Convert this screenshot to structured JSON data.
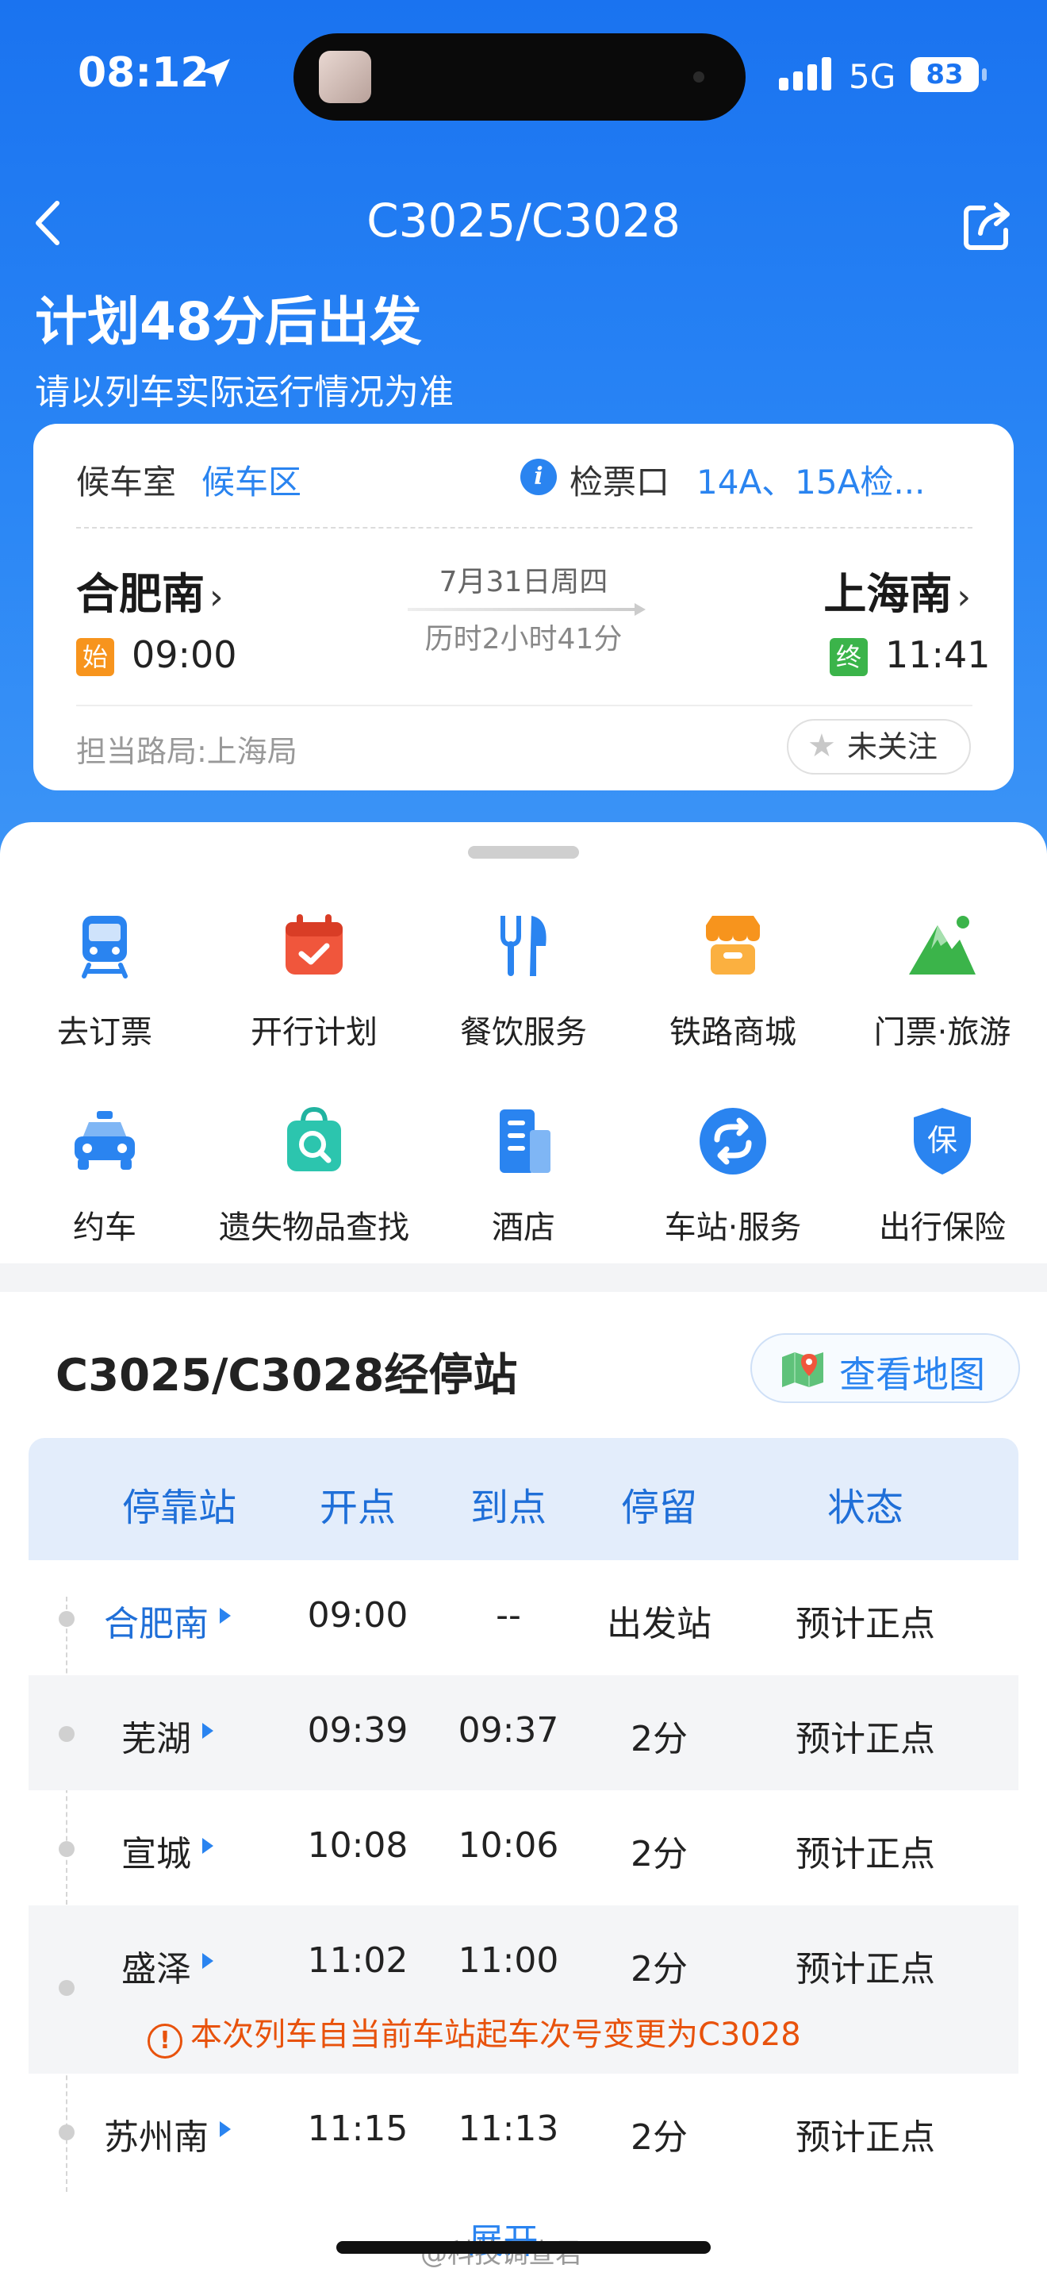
{
  "status_bar": {
    "time": "08:12",
    "network": "5G",
    "battery": "83"
  },
  "nav": {
    "title": "C3025/C3028"
  },
  "header": {
    "title": "计划48分后出发",
    "subtitle": "请以列车实际运行情况为准"
  },
  "trip_card": {
    "waiting_room_label": "候车室",
    "waiting_room_value": "候车区",
    "gate_label": "检票口",
    "gate_value": "14A、15A检...",
    "from_station": "合肥南",
    "from_badge": "始",
    "from_time": "09:00",
    "to_station": "上海南",
    "to_badge": "终",
    "to_time": "11:41",
    "date": "7月31日周四",
    "duration": "历时2小时41分",
    "bureau": "担当路局:上海局",
    "follow_label": "未关注"
  },
  "services": [
    {
      "label": "去订票",
      "icon": "train-ticket-icon"
    },
    {
      "label": "开行计划",
      "icon": "calendar-icon"
    },
    {
      "label": "餐饮服务",
      "icon": "dining-icon"
    },
    {
      "label": "铁路商城",
      "icon": "shop-icon"
    },
    {
      "label": "门票·旅游",
      "icon": "mountain-icon"
    },
    {
      "label": "约车",
      "icon": "taxi-icon"
    },
    {
      "label": "遗失物品查找",
      "icon": "lost-found-icon"
    },
    {
      "label": "酒店",
      "icon": "hotel-icon"
    },
    {
      "label": "车站·服务",
      "icon": "station-service-icon"
    },
    {
      "label": "出行保险",
      "icon": "insurance-shield-icon"
    }
  ],
  "stops": {
    "title": "C3025/C3028经停站",
    "map_button": "查看地图",
    "headers": [
      "停靠站",
      "开点",
      "到点",
      "停留",
      "状态"
    ],
    "rows": [
      {
        "station": "合肥南",
        "depart": "09:00",
        "arrive": "--",
        "stay": "出发站",
        "status": "预计正点"
      },
      {
        "station": "芜湖",
        "depart": "09:39",
        "arrive": "09:37",
        "stay": "2分",
        "status": "预计正点"
      },
      {
        "station": "宣城",
        "depart": "10:08",
        "arrive": "10:06",
        "stay": "2分",
        "status": "预计正点"
      },
      {
        "station": "盛泽",
        "depart": "11:02",
        "arrive": "11:00",
        "stay": "2分",
        "status": "预计正点"
      },
      {
        "station": "苏州南",
        "depart": "11:15",
        "arrive": "11:13",
        "stay": "2分",
        "status": "预计正点"
      }
    ],
    "notice": "本次列车自当前车站起车次号变更为C3028",
    "expand_label": "展开"
  },
  "watermark": "@科技调查君",
  "colors": {
    "primary": "#1a73f0",
    "accent_blue": "#2a84f0",
    "start_badge": "#f7941d",
    "end_badge": "#3bb44a",
    "notice": "#e8520c"
  }
}
